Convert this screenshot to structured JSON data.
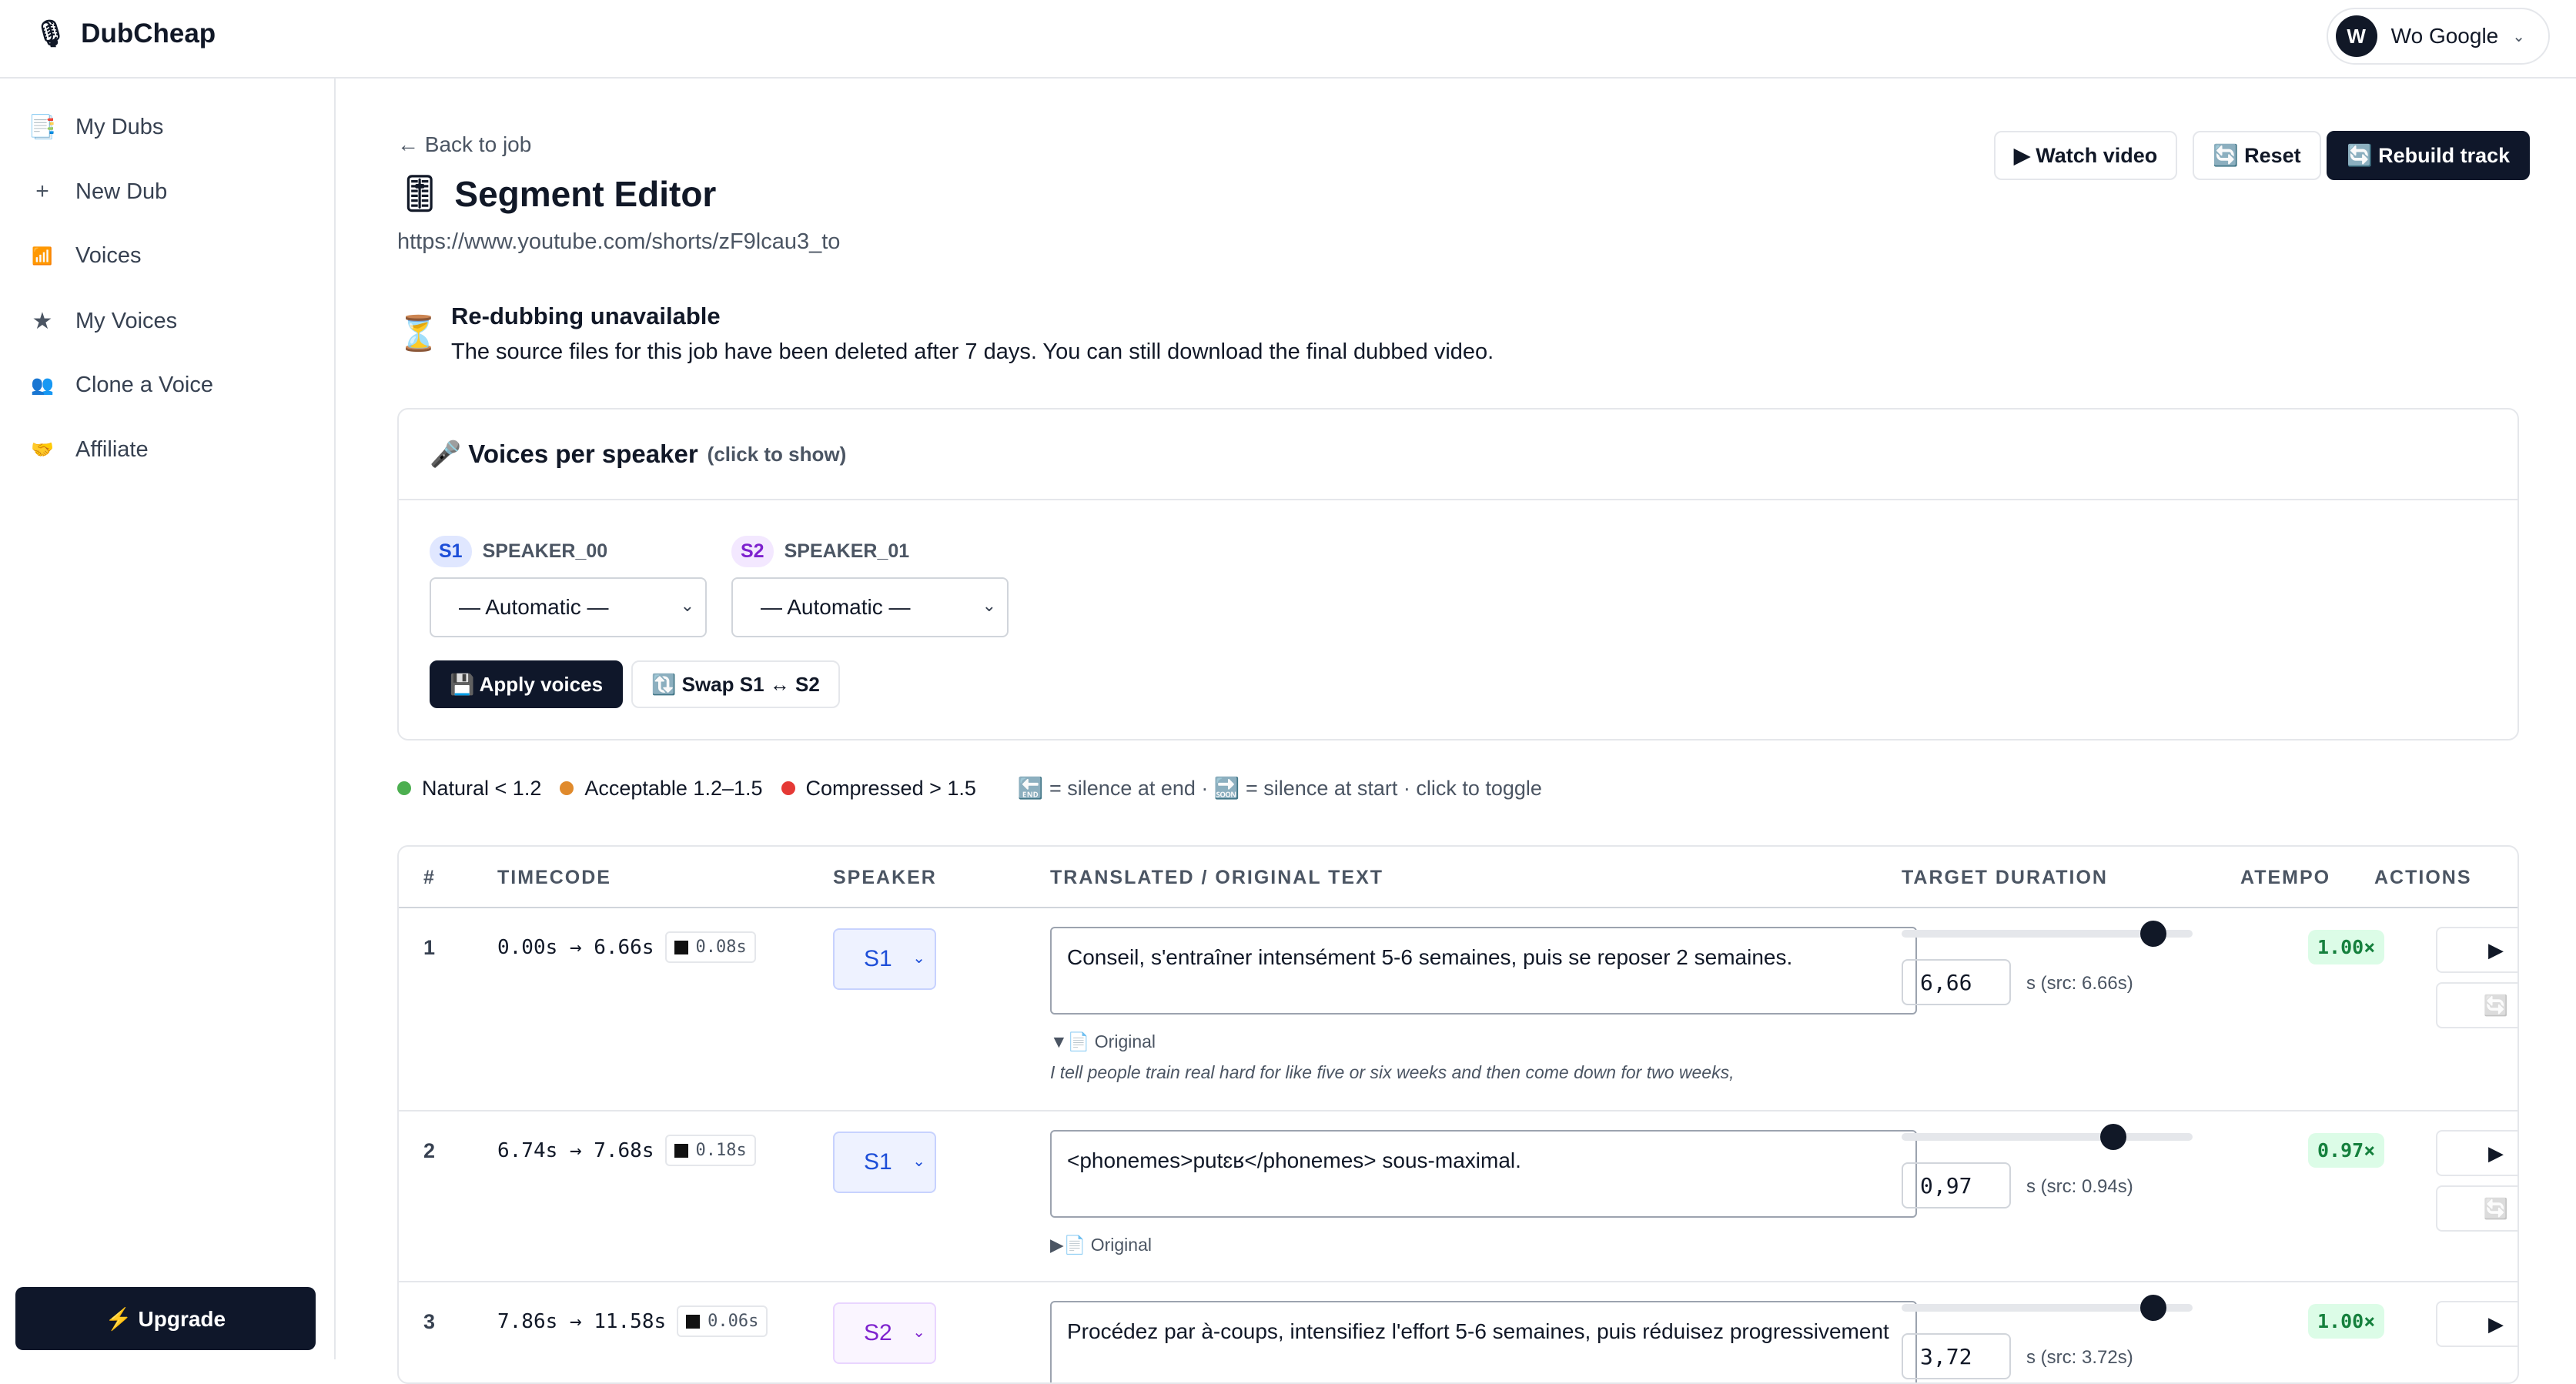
{
  "app": {
    "name": "DubCheap",
    "logo_icon": "🎙"
  },
  "account": {
    "initial": "W",
    "name": "Wo Google"
  },
  "sidebar": {
    "items": [
      {
        "label": "My Dubs",
        "icon": "📑"
      },
      {
        "label": "New Dub",
        "icon": "+"
      },
      {
        "label": "Voices",
        "icon": "📶"
      },
      {
        "label": "My Voices",
        "icon": "★"
      },
      {
        "label": "Clone a Voice",
        "icon": "👥"
      },
      {
        "label": "Affiliate",
        "icon": "🤝"
      }
    ],
    "upgrade": "⚡ Upgrade"
  },
  "header": {
    "back": "← Back to job",
    "title_icon": "🎚",
    "title": "Segment Editor",
    "url": "https://www.youtube.com/shorts/zF9lcau3_to",
    "watch": "▶ Watch video",
    "reset": "🔄 Reset",
    "rebuild": "🔄 Rebuild track"
  },
  "notice": {
    "icon": "⏳",
    "heading": "Re-dubbing unavailable",
    "text": "The source files for this job have been deleted after 7 days. You can still download the final dubbed video."
  },
  "voices": {
    "heading": "🎤 Voices per speaker",
    "hint": "(click to show)",
    "speakers": [
      {
        "chip": "S1",
        "name": "SPEAKER_00",
        "value": "— Automatic —"
      },
      {
        "chip": "S2",
        "name": "SPEAKER_01",
        "value": "— Automatic —"
      }
    ],
    "apply": "💾 Apply voices",
    "swap": "🔃 Swap S1 ↔ S2"
  },
  "legend": {
    "natural": "Natural < 1.2",
    "acceptable": "Acceptable 1.2–1.5",
    "compressed": "Compressed > 1.5",
    "silence": "🔚 = silence at end · 🔜 = silence at start · click to toggle",
    "colors": {
      "natural": "#4caf50",
      "acceptable": "#e08a2c",
      "compressed": "#e53935"
    }
  },
  "table": {
    "headers": [
      "#",
      "TIMECODE",
      "SPEAKER",
      "TRANSLATED / ORIGINAL TEXT",
      "TARGET DURATION",
      "ATEMPO",
      "ACTIONS"
    ],
    "rows": [
      {
        "num": "1",
        "timecode": "0.00s → 6.66s",
        "gap": "0.08s",
        "speaker": "S1",
        "text": "Conseil, s'entraîner intensément 5-6 semaines, puis se reposer 2 semaines.",
        "original_toggle": "▼📄 Original",
        "original": "I tell people train real hard for like five or six weeks and then come down for two weeks,",
        "duration": "6,66",
        "src": "s  (src: 6.66s)",
        "atempo": "1.00×",
        "slider": 0.9
      },
      {
        "num": "2",
        "timecode": "6.74s → 7.68s",
        "gap": "0.18s",
        "speaker": "S1",
        "text": "<phonemes>putɛʁ</phonemes> sous-maximal.",
        "original_toggle": "▶📄 Original",
        "original": "",
        "duration": "0,97",
        "src": "s  (src: 0.94s)",
        "atempo": "0.97×",
        "slider": 0.75
      },
      {
        "num": "3",
        "timecode": "7.86s → 11.58s",
        "gap": "0.06s",
        "speaker": "S2",
        "text": "Procédez par à-coups, intensifiez l'effort 5-6 semaines, puis réduisez progressivement",
        "original_toggle": "",
        "original": "",
        "duration": "3,72",
        "src": "s  (src: 3.72s)",
        "atempo": "1.00×",
        "slider": 0.9
      }
    ],
    "play": "▶",
    "regen": "🔄"
  }
}
